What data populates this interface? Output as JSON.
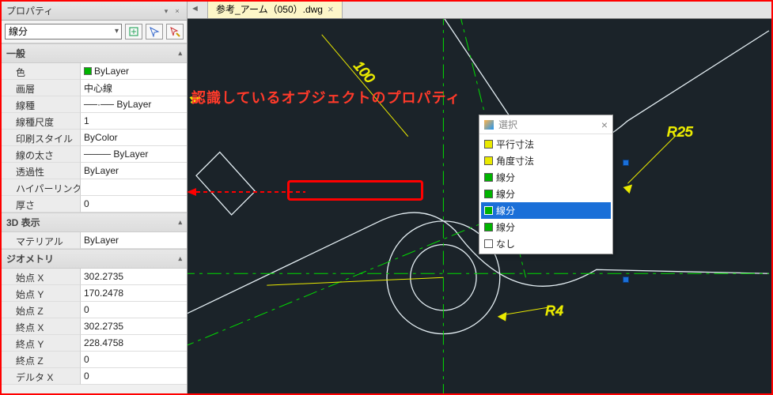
{
  "panel": {
    "title": "プロパティ",
    "object_type": "線分"
  },
  "groups": {
    "general": {
      "header": "一般",
      "rows": [
        {
          "label": "色",
          "value": "ByLayer",
          "swatch": "#00b400"
        },
        {
          "label": "画層",
          "value": "中心線"
        },
        {
          "label": "線種",
          "value": "──·── ByLayer"
        },
        {
          "label": "線種尺度",
          "value": "1"
        },
        {
          "label": "印刷スタイル",
          "value": "ByColor"
        },
        {
          "label": "線の太さ",
          "value": "──── ByLayer"
        },
        {
          "label": "透過性",
          "value": "ByLayer"
        },
        {
          "label": "ハイパーリンク",
          "value": ""
        },
        {
          "label": "厚さ",
          "value": "0"
        }
      ]
    },
    "threeD": {
      "header": "3D 表示",
      "rows": [
        {
          "label": "マテリアル",
          "value": "ByLayer"
        }
      ]
    },
    "geometry": {
      "header": "ジオメトリ",
      "rows": [
        {
          "label": "始点 X",
          "value": "302.2735"
        },
        {
          "label": "始点 Y",
          "value": "170.2478"
        },
        {
          "label": "始点 Z",
          "value": "0"
        },
        {
          "label": "終点 X",
          "value": "302.2735"
        },
        {
          "label": "終点 Y",
          "value": "228.4758"
        },
        {
          "label": "終点 Z",
          "value": "0"
        },
        {
          "label": "デルタ X",
          "value": "0"
        }
      ]
    }
  },
  "document_tab": "参考_アーム（050）.dwg",
  "annotation_text": "認識しているオブジェクトのプロパティ",
  "selection_popup": {
    "title": "選択",
    "items": [
      {
        "label": "平行寸法",
        "color": "#eaea00"
      },
      {
        "label": "角度寸法",
        "color": "#eaea00"
      },
      {
        "label": "線分",
        "color": "#00b400"
      },
      {
        "label": "線分",
        "color": "#00b400"
      },
      {
        "label": "線分",
        "color": "#00b400",
        "selected": true
      },
      {
        "label": "線分",
        "color": "#00b400"
      },
      {
        "label": "なし",
        "color": "#ffffff"
      }
    ]
  },
  "dims": {
    "d100": "100",
    "r25": "R25",
    "r4": "R4"
  },
  "colors": {
    "accent_green": "#00e000",
    "accent_yellow": "#eaea00",
    "canvas_stroke": "#e6f0f5"
  }
}
